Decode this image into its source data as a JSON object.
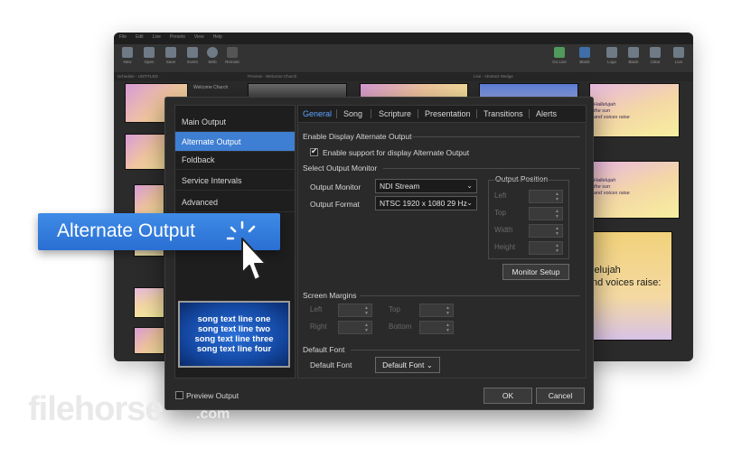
{
  "bg": {
    "menu": [
      "File",
      "Edit",
      "Live",
      "Presets",
      "View",
      "Help"
    ],
    "toolbar": [
      "New",
      "Open",
      "Save",
      "Event",
      "Web",
      "Remote",
      "Go Live",
      "Blank",
      "Logo",
      "Black",
      "Clear",
      "Live"
    ],
    "panels": [
      "Schedule - UNTITLED",
      "Preview - Welcome Church",
      "Live - Abstract Wedge"
    ],
    "schedule_item": "Welcome Church",
    "lyrics": [
      "Hallelujah",
      "the sun",
      "and voices raise",
      "Hallelujah",
      "the sun",
      "and voices raise"
    ],
    "big_lyric": [
      "lelujah",
      "nd voices raise:"
    ]
  },
  "dialog": {
    "nav": [
      "Main Output",
      "Alternate Output",
      "Foldback",
      "Service Intervals",
      "Advanced"
    ],
    "tabs": [
      "General",
      "Song",
      "Scripture",
      "Presentation",
      "Transitions",
      "Alerts"
    ],
    "general": {
      "enable_section": "Enable Display Alternate Output",
      "enable_label": "Enable support for display Alternate Output",
      "check_mark": "✔",
      "monitor_section": "Select Output Monitor",
      "output_monitor_label": "Output Monitor",
      "output_monitor_value": "NDI Stream",
      "output_format_label": "Output Format",
      "output_format_value": "NTSC 1920 x 1080 29 Hz",
      "chevron": "⌄",
      "arrow_up": "▲",
      "arrow_down": "▼",
      "position_section": "Output Position",
      "position": [
        "Left",
        "Top",
        "Width",
        "Height"
      ],
      "monitor_setup": "Monitor Setup",
      "margins_section": "Screen Margins",
      "margins": [
        "Left",
        "Top",
        "Right",
        "Bottom"
      ],
      "font_section": "Default Font",
      "default_font_label": "Default Font",
      "default_font_button": "Default Font "
    },
    "preview_lines": [
      "song text line one",
      "song text line two",
      "song text line three",
      "song text line four"
    ],
    "preview_output": "Preview Output",
    "ok": "OK",
    "cancel": "Cancel"
  },
  "callout": {
    "label": "Alternate Output"
  },
  "watermark": {
    "name": "filehorse",
    "tld": ".com"
  },
  "colors": {
    "accent": "#3f7fd3",
    "tab_active": "#5aa3ff",
    "dialog_bg": "#2a2a2a"
  }
}
